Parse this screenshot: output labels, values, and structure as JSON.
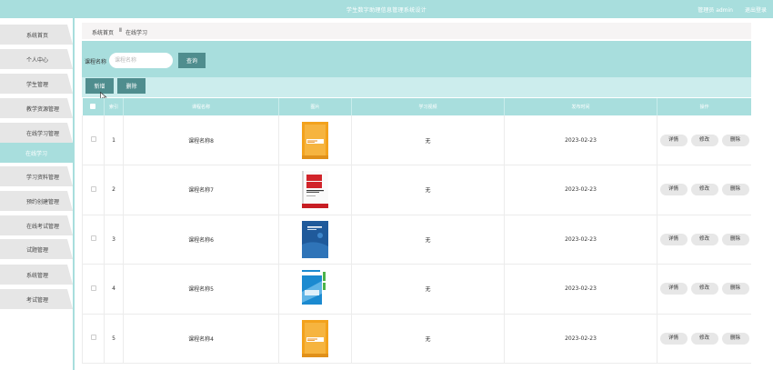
{
  "header": {
    "title": "学生数字助理信息管理系统设计",
    "user_label": "管理员 admin",
    "logout_label": "退出登录"
  },
  "sidebar": {
    "items": [
      {
        "label": "系统首页",
        "icon": "home-icon"
      },
      {
        "label": "个人中心",
        "icon": "user-icon"
      },
      {
        "label": "学生管理",
        "icon": "flag-icon"
      },
      {
        "label": "教学资源管理",
        "icon": "flag-icon"
      },
      {
        "label": "在线学习管理",
        "icon": "grid-icon"
      },
      {
        "label": "在线学习",
        "icon": ""
      },
      {
        "label": "学习资料管理",
        "icon": "stack-icon"
      },
      {
        "label": "预约创建管理",
        "icon": "grid-icon"
      },
      {
        "label": "在线考试管理",
        "icon": "grid-icon"
      },
      {
        "label": "试题管理",
        "icon": "trophy-icon"
      },
      {
        "label": "系统管理",
        "icon": "grid-icon"
      },
      {
        "label": "考试管理",
        "icon": "grid-icon"
      }
    ],
    "active_index": 5
  },
  "breadcrumb": {
    "home": "系统首页",
    "separator": "Ⅱ",
    "current": "在线学习"
  },
  "search": {
    "label": "课程名称",
    "placeholder": "课程名称",
    "value": "",
    "button_label": "查询"
  },
  "actions": {
    "add_label": "新增",
    "delete_label": "删除"
  },
  "table": {
    "columns": [
      "",
      "索引",
      "课程名称",
      "图片",
      "学习视频",
      "发布时间",
      "操作"
    ],
    "rows": [
      {
        "index": "1",
        "name": "课程名称8",
        "video": "无",
        "date": "2023-02-23",
        "cover": "orange"
      },
      {
        "index": "2",
        "name": "课程名称7",
        "video": "无",
        "date": "2023-02-23",
        "cover": "white-red"
      },
      {
        "index": "3",
        "name": "课程名称6",
        "video": "无",
        "date": "2023-02-23",
        "cover": "blue"
      },
      {
        "index": "4",
        "name": "课程名称5",
        "video": "无",
        "date": "2023-02-23",
        "cover": "blue-green"
      },
      {
        "index": "5",
        "name": "课程名称4",
        "video": "无",
        "date": "2023-02-23",
        "cover": "orange"
      }
    ],
    "op_labels": {
      "detail": "详情",
      "edit": "修改",
      "delete": "删除"
    }
  },
  "colors": {
    "accent": "#a8dedd",
    "button": "#4f8d8e",
    "action_bar": "#cceded"
  }
}
